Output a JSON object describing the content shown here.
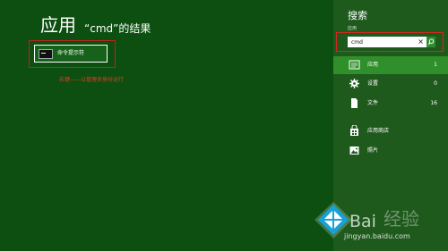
{
  "results_page": {
    "title": "应用",
    "subtitle": "“cmd”的结果",
    "result_item": {
      "label": "命令提示符"
    },
    "annotation": "右键——以管理员身份运行"
  },
  "search_pane": {
    "title": "搜索",
    "scope_label": "应用",
    "query_value": "cmd",
    "clear_label": "×",
    "scopes": [
      {
        "label": "应用",
        "count": "1",
        "icon": "apps-icon",
        "selected": true
      },
      {
        "label": "设置",
        "count": "0",
        "icon": "gear-icon"
      },
      {
        "label": "文件",
        "count": "16",
        "icon": "document-icon"
      },
      {
        "label": "应用商店",
        "count": "",
        "icon": "store-icon"
      },
      {
        "label": "照片",
        "count": "",
        "icon": "photo-icon"
      }
    ]
  },
  "watermark": {
    "text_left": "Bai",
    "text_right": "经验",
    "url": "jingyan.baidu.com"
  },
  "colors": {
    "main_background": "#0c4f10",
    "panel_background": "#1f5a1d",
    "selected_row": "#2f8f2a",
    "highlight_border": "#c0221b",
    "annotation_text": "#e83a2a"
  }
}
